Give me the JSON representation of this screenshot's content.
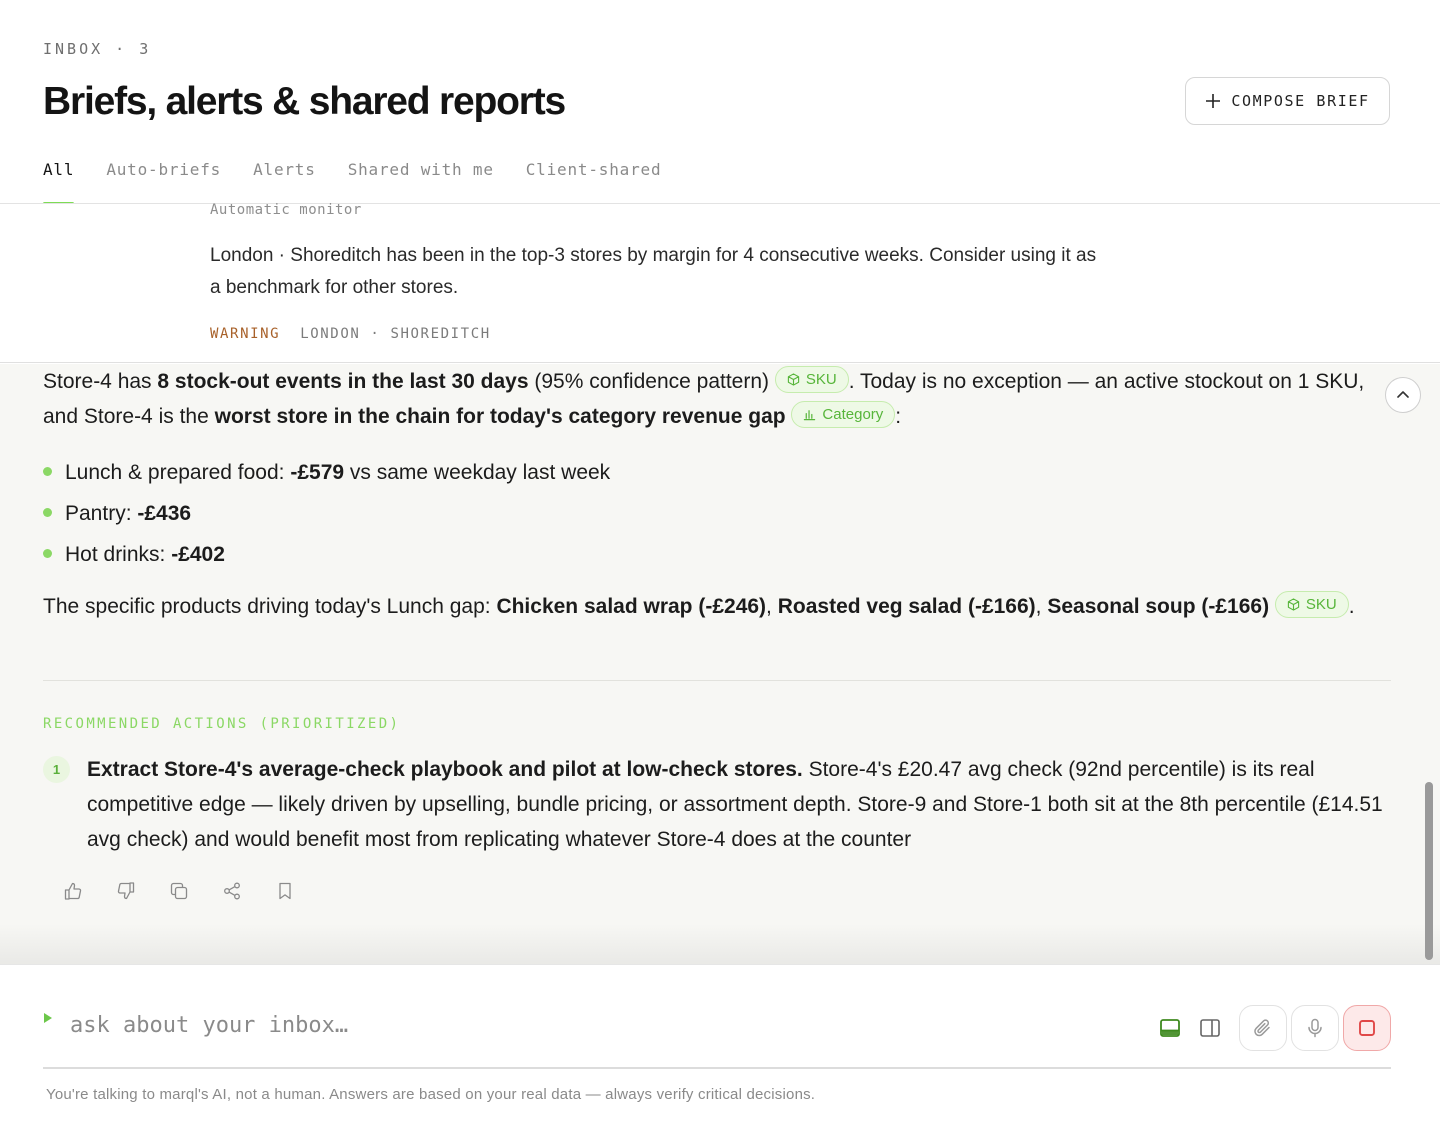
{
  "header": {
    "eyebrow": "INBOX · 3",
    "title": "Briefs, alerts & shared reports",
    "compose_label": "COMPOSE BRIEF",
    "tabs": [
      "All",
      "Auto-briefs",
      "Alerts",
      "Shared with me",
      "Client-shared"
    ],
    "active_tab": "All"
  },
  "alert": {
    "source": "Automatic monitor",
    "body": "London · Shoreditch has been in the top-3 stores by margin for 4 consecutive weeks. Consider using it as a benchmark for other stores.",
    "severity": "WARNING",
    "location": "LONDON · SHOREDITCH"
  },
  "brief": {
    "intro": {
      "t1": "Store-4 has ",
      "b1": "8 stock-out events in the last 30 days",
      "t2": " (95% confidence pattern) ",
      "chip1": "SKU",
      "t3": ". Today is no exception — an active stockout on 1 SKU, and Store-4 is the ",
      "b2": "worst store in the chain for today's category revenue gap",
      "t4": " ",
      "chip2": "Category",
      "t5": ":"
    },
    "bullets": [
      {
        "label": "Lunch & prepared food: ",
        "value": "-£579",
        "suffix": " vs same weekday last week"
      },
      {
        "label": "Pantry: ",
        "value": "-£436",
        "suffix": ""
      },
      {
        "label": "Hot drinks: ",
        "value": "-£402",
        "suffix": ""
      }
    ],
    "products": {
      "t1": "The specific products driving today's Lunch gap: ",
      "p1": "Chicken salad wrap (-£246)",
      "sep1": ", ",
      "p2": "Roasted veg salad (-£166)",
      "sep2": ", ",
      "p3": "Seasonal soup (-£166)",
      "t2": " ",
      "chip": "SKU",
      "t3": "."
    },
    "section_label": "RECOMMENDED ACTIONS (PRIORITIZED)",
    "actions": [
      {
        "num": "1",
        "title": "Extract Store-4's average-check playbook and pilot at low-check stores.",
        "body": " Store-4's £20.47 avg check (92nd percentile) is its real competitive edge — likely driven by upselling, bundle pricing, or assortment depth. Store-9 and Store-1 both sit at the 8th percentile (£14.51 avg check) and would benefit most from replicating whatever Store-4 does at the counter"
      }
    ],
    "feedback_icons": [
      "thumbs-up-icon",
      "thumbs-down-icon",
      "copy-icon",
      "share-icon",
      "bookmark-icon"
    ]
  },
  "composer": {
    "placeholder": "ask about your inbox…",
    "disclaimer": "You're talking to marql's AI, not a human. Answers are based on your real data — always verify critical decisions."
  },
  "colors": {
    "accent": "#7ddc55",
    "chip_text": "#57b53a",
    "warning": "#a8612a",
    "stop": "#e04848"
  }
}
